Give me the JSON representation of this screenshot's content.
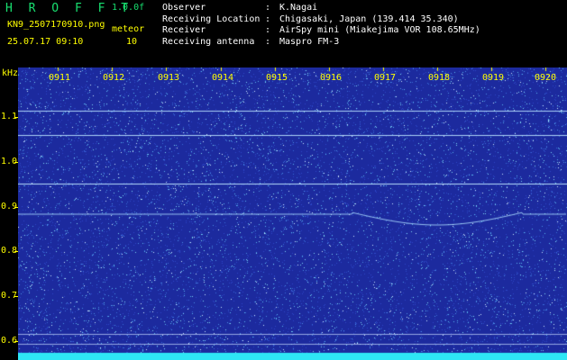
{
  "header": {
    "brand": "H R O F F T",
    "version": "1.0.0f",
    "filename": "KN9_2507170910.png",
    "datetime": "25.07.17 09:10",
    "mode_label": "meteor",
    "mode_value": "10"
  },
  "meta": [
    {
      "key": "Observer",
      "value": "K.Nagai"
    },
    {
      "key": "Receiving Location",
      "value": "Chigasaki, Japan (139.414 35.340)"
    },
    {
      "key": "Receiver",
      "value": "AirSpy mini (Miakejima VOR 108.65MHz)"
    },
    {
      "key": "Receiving antenna",
      "value": "Maspro FM-3"
    }
  ],
  "axis": {
    "unit": "kHz",
    "y_ticks": [
      "1.1",
      "1.0",
      "0.9",
      "0.8",
      "0.7",
      "0.6"
    ],
    "time_ticks": [
      "0911",
      "0912",
      "0913",
      "0914",
      "0915",
      "0916",
      "0917",
      "0918",
      "0919",
      "0920"
    ]
  },
  "colors": {
    "background": "#1c2a9e",
    "accent": "#ffff00",
    "brand": "#18e070"
  }
}
